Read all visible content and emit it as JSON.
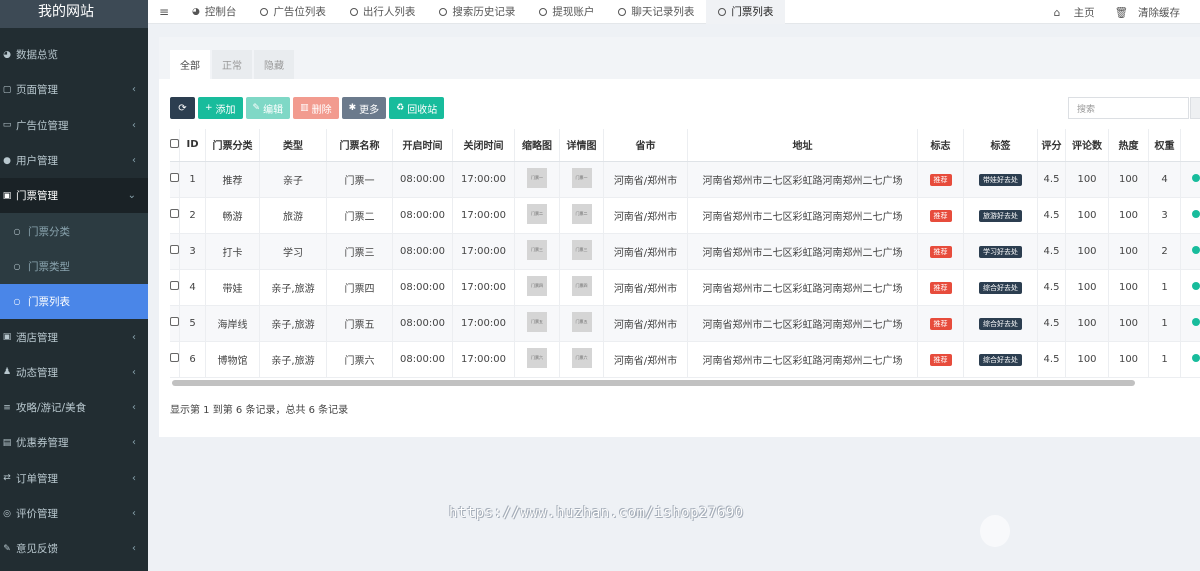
{
  "sidebar": {
    "logo": "我的网站",
    "items": [
      {
        "icon": "dashboard-icon",
        "glyph": "◕",
        "label": "数据总览"
      },
      {
        "icon": "file-icon",
        "glyph": "▢",
        "label": "页面管理",
        "caret": "‹"
      },
      {
        "icon": "ad-icon",
        "glyph": "▭",
        "label": "广告位管理",
        "caret": "‹"
      },
      {
        "icon": "user-icon",
        "glyph": "●",
        "label": "用户管理",
        "caret": "‹"
      },
      {
        "icon": "ticket-icon",
        "glyph": "▣",
        "label": "门票管理",
        "caret": "⌄"
      },
      {
        "icon": "circle-icon",
        "glyph": "○",
        "label": "门票分类"
      },
      {
        "icon": "circle-icon",
        "glyph": "○",
        "label": "门票类型"
      },
      {
        "icon": "circle-icon",
        "glyph": "○",
        "label": "门票列表"
      },
      {
        "icon": "hotel-icon",
        "glyph": "▣",
        "label": "酒店管理",
        "caret": "‹"
      },
      {
        "icon": "walk-icon",
        "glyph": "♟",
        "label": "动态管理",
        "caret": "‹"
      },
      {
        "icon": "guide-icon",
        "glyph": "≡",
        "label": "攻略/游记/美食",
        "caret": "‹"
      },
      {
        "icon": "coupon-icon",
        "glyph": "▤",
        "label": "优惠券管理",
        "caret": "‹"
      },
      {
        "icon": "order-icon",
        "glyph": "⇄",
        "label": "订单管理",
        "caret": "‹"
      },
      {
        "icon": "comment-icon",
        "glyph": "◎",
        "label": "评价管理",
        "caret": "‹"
      },
      {
        "icon": "feedback-icon",
        "glyph": "✎",
        "label": "意见反馈",
        "caret": "‹"
      }
    ]
  },
  "topbar": {
    "toggle": "≡",
    "tabs": [
      {
        "label": "控制台",
        "icon": "gauge"
      },
      {
        "label": "广告位列表"
      },
      {
        "label": "出行人列表"
      },
      {
        "label": "搜索历史记录"
      },
      {
        "label": "提现账户"
      },
      {
        "label": "聊天记录列表"
      },
      {
        "label": "门票列表",
        "active": true
      }
    ],
    "home": "主页",
    "clear_cache": "清除缓存"
  },
  "content": {
    "filter_tabs": [
      "全部",
      "正常",
      "隐藏"
    ],
    "toolbar": {
      "add": "添加",
      "edit": "编辑",
      "delete": "删除",
      "more": "更多",
      "recycle": "回收站"
    },
    "search_placeholder": "搜索",
    "columns": [
      "ID",
      "门票分类",
      "类型",
      "门票名称",
      "开启时间",
      "关闭时间",
      "缩略图",
      "详情图",
      "省市",
      "地址",
      "标志",
      "标签",
      "评分",
      "评论数",
      "热度",
      "权重"
    ],
    "rows": [
      {
        "id": "1",
        "category": "推荐",
        "type": "亲子",
        "name": "门票一",
        "open": "08:00:00",
        "close": "17:00:00",
        "thumb": "门票一",
        "detail": "门票一",
        "region": "河南省/郑州市",
        "address": "河南省郑州市二七区彩虹路河南郑州二七广场",
        "flag": "推荐",
        "tag": "带娃好去处",
        "rating": "4.5",
        "comments": "100",
        "heat": "100",
        "weight": "4"
      },
      {
        "id": "2",
        "category": "畅游",
        "type": "旅游",
        "name": "门票二",
        "open": "08:00:00",
        "close": "17:00:00",
        "thumb": "门票二",
        "detail": "门票二",
        "region": "河南省/郑州市",
        "address": "河南省郑州市二七区彩虹路河南郑州二七广场",
        "flag": "推荐",
        "tag": "旅游好去处",
        "rating": "4.5",
        "comments": "100",
        "heat": "100",
        "weight": "3"
      },
      {
        "id": "3",
        "category": "打卡",
        "type": "学习",
        "name": "门票三",
        "open": "08:00:00",
        "close": "17:00:00",
        "thumb": "门票三",
        "detail": "门票三",
        "region": "河南省/郑州市",
        "address": "河南省郑州市二七区彩虹路河南郑州二七广场",
        "flag": "推荐",
        "tag": "学习好去处",
        "rating": "4.5",
        "comments": "100",
        "heat": "100",
        "weight": "2"
      },
      {
        "id": "4",
        "category": "带娃",
        "type": "亲子,旅游",
        "name": "门票四",
        "open": "08:00:00",
        "close": "17:00:00",
        "thumb": "门票四",
        "detail": "门票四",
        "region": "河南省/郑州市",
        "address": "河南省郑州市二七区彩虹路河南郑州二七广场",
        "flag": "推荐",
        "tag": "综合好去处",
        "rating": "4.5",
        "comments": "100",
        "heat": "100",
        "weight": "1"
      },
      {
        "id": "5",
        "category": "海岸线",
        "type": "亲子,旅游",
        "name": "门票五",
        "open": "08:00:00",
        "close": "17:00:00",
        "thumb": "门票五",
        "detail": "门票五",
        "region": "河南省/郑州市",
        "address": "河南省郑州市二七区彩虹路河南郑州二七广场",
        "flag": "推荐",
        "tag": "综合好去处",
        "rating": "4.5",
        "comments": "100",
        "heat": "100",
        "weight": "1"
      },
      {
        "id": "6",
        "category": "博物馆",
        "type": "亲子,旅游",
        "name": "门票六",
        "open": "08:00:00",
        "close": "17:00:00",
        "thumb": "门票六",
        "detail": "门票六",
        "region": "河南省/郑州市",
        "address": "河南省郑州市二七区彩虹路河南郑州二七广场",
        "flag": "推荐",
        "tag": "综合好去处",
        "rating": "4.5",
        "comments": "100",
        "heat": "100",
        "weight": "1"
      }
    ],
    "page_info": "显示第 1 到第 6 条记录，总共 6 条记录"
  },
  "watermark": "https://www.huzhan.com/ishop27690",
  "colors": {
    "sidebar_bg": "#222d32",
    "active_blue": "#4a86e8",
    "success": "#18bc9c",
    "danger": "#e74c3c",
    "dark": "#2c3e50"
  }
}
